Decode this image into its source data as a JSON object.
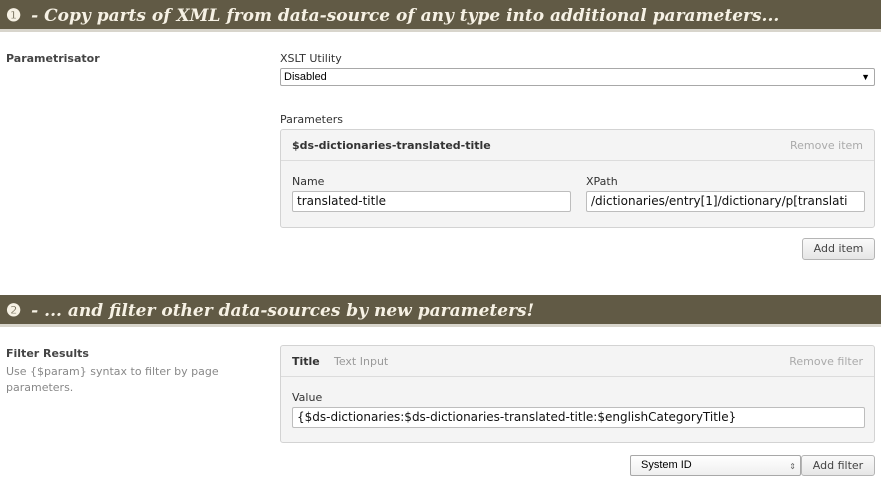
{
  "section1": {
    "step": "❶",
    "heading": "- Copy parts of XML from data-source of any type into additional parameters...",
    "label": "Parametrisator",
    "xslt_label": "XSLT Utility",
    "xslt_value": "Disabled",
    "parameters_label": "Parameters",
    "item": {
      "title": "$ds-dictionaries-translated-title",
      "remove": "Remove item",
      "name_label": "Name",
      "name_value": "translated-title",
      "xpath_label": "XPath",
      "xpath_value": "/dictionaries/entry[1]/dictionary/p[translati"
    },
    "add_item": "Add item"
  },
  "section2": {
    "step": "❷",
    "heading": "- ... and filter other data-sources by new parameters!",
    "label": "Filter Results",
    "help": "Use {$param} syntax to filter by page parameters.",
    "filter": {
      "title": "Title",
      "type": "Text Input",
      "remove": "Remove filter",
      "value_label": "Value",
      "value": "{$ds-dictionaries:$ds-dictionaries-translated-title:$englishCategoryTitle}"
    },
    "select_value": "System ID",
    "add_filter": "Add filter"
  }
}
